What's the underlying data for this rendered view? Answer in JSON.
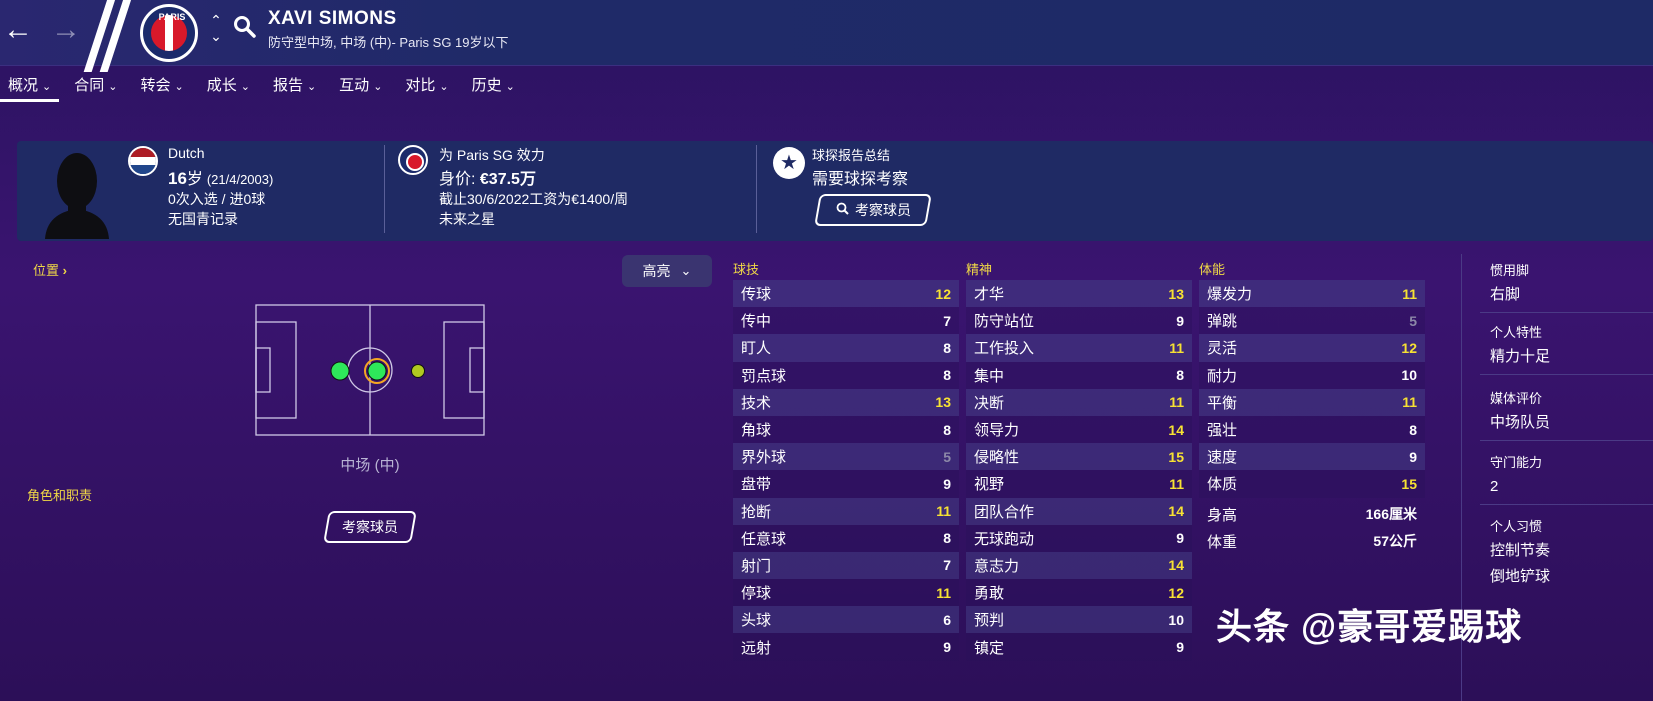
{
  "header": {
    "player_name": "XAVI SIMONS",
    "player_subtitle": "防守型中场, 中场 (中)- Paris SG 19岁以下",
    "club_badge_text": "PARIS"
  },
  "tabs": [
    {
      "label": "概况"
    },
    {
      "label": "合同"
    },
    {
      "label": "转会"
    },
    {
      "label": "成长"
    },
    {
      "label": "报告"
    },
    {
      "label": "互动"
    },
    {
      "label": "对比"
    },
    {
      "label": "历史"
    }
  ],
  "info": {
    "nationality": "Dutch",
    "age": "16",
    "age_suffix": "岁",
    "dob": "(21/4/2003)",
    "caps": "0次入选 / 进0球",
    "youth_record": "无国青记录",
    "plays_for": "为 Paris SG 效力",
    "value_label": "身价: ",
    "value": "€37.5万",
    "contract": "截止30/6/2022工资为€1400/周",
    "status": "未来之星",
    "scout_title": "球探报告总结",
    "scout_text": "需要球探考察",
    "scout_button": "考察球员"
  },
  "position": {
    "label": "位置",
    "highlight_button": "高亮",
    "pitch_position": "中场 (中)",
    "role_label": "角色和职责",
    "scout_button": "考察球员"
  },
  "attributes": {
    "technical_title": "球技",
    "mental_title": "精神",
    "physical_title": "体能",
    "technical": [
      {
        "name": "传球",
        "value": "12",
        "tone": "yellow"
      },
      {
        "name": "传中",
        "value": "7",
        "tone": "white"
      },
      {
        "name": "盯人",
        "value": "8",
        "tone": "white"
      },
      {
        "name": "罚点球",
        "value": "8",
        "tone": "white"
      },
      {
        "name": "技术",
        "value": "13",
        "tone": "yellow"
      },
      {
        "name": "角球",
        "value": "8",
        "tone": "white"
      },
      {
        "name": "界外球",
        "value": "5",
        "tone": "grey"
      },
      {
        "name": "盘带",
        "value": "9",
        "tone": "white"
      },
      {
        "name": "抢断",
        "value": "11",
        "tone": "yellow"
      },
      {
        "name": "任意球",
        "value": "8",
        "tone": "white"
      },
      {
        "name": "射门",
        "value": "7",
        "tone": "white"
      },
      {
        "name": "停球",
        "value": "11",
        "tone": "yellow"
      },
      {
        "name": "头球",
        "value": "6",
        "tone": "white"
      },
      {
        "name": "远射",
        "value": "9",
        "tone": "white"
      }
    ],
    "mental": [
      {
        "name": "才华",
        "value": "13",
        "tone": "yellow"
      },
      {
        "name": "防守站位",
        "value": "9",
        "tone": "white"
      },
      {
        "name": "工作投入",
        "value": "11",
        "tone": "yellow"
      },
      {
        "name": "集中",
        "value": "8",
        "tone": "white"
      },
      {
        "name": "决断",
        "value": "11",
        "tone": "yellow"
      },
      {
        "name": "领导力",
        "value": "14",
        "tone": "yellow"
      },
      {
        "name": "侵略性",
        "value": "15",
        "tone": "yellow"
      },
      {
        "name": "视野",
        "value": "11",
        "tone": "yellow"
      },
      {
        "name": "团队合作",
        "value": "14",
        "tone": "yellow"
      },
      {
        "name": "无球跑动",
        "value": "9",
        "tone": "white"
      },
      {
        "name": "意志力",
        "value": "14",
        "tone": "yellow"
      },
      {
        "name": "勇敢",
        "value": "12",
        "tone": "yellow"
      },
      {
        "name": "预判",
        "value": "10",
        "tone": "white"
      },
      {
        "name": "镇定",
        "value": "9",
        "tone": "white"
      }
    ],
    "physical": [
      {
        "name": "爆发力",
        "value": "11",
        "tone": "yellow"
      },
      {
        "name": "弹跳",
        "value": "5",
        "tone": "grey"
      },
      {
        "name": "灵活",
        "value": "12",
        "tone": "yellow"
      },
      {
        "name": "耐力",
        "value": "10",
        "tone": "white"
      },
      {
        "name": "平衡",
        "value": "11",
        "tone": "yellow"
      },
      {
        "name": "强壮",
        "value": "8",
        "tone": "white"
      },
      {
        "name": "速度",
        "value": "9",
        "tone": "white"
      },
      {
        "name": "体质",
        "value": "15",
        "tone": "yellow"
      }
    ],
    "height_label": "身高",
    "height_value": "166厘米",
    "weight_label": "体重",
    "weight_value": "57公斤"
  },
  "sidebar": {
    "foot_title": "惯用脚",
    "foot_value": "右脚",
    "personality_title": "个人特性",
    "personality_value": "精力十足",
    "media_title": "媒体评价",
    "media_value": "中场队员",
    "gk_title": "守门能力",
    "gk_value": "2",
    "habits_title": "个人习惯",
    "habit_1": "控制节奏",
    "habit_2": "倒地铲球"
  },
  "watermark": "头条 @豪哥爱踢球",
  "colors": {
    "highlight": "#f7e233",
    "normal": "#ffffff",
    "low": "#8c88a8",
    "position_natural": "#2ee85a",
    "position_accomplished": "#b0c820"
  }
}
